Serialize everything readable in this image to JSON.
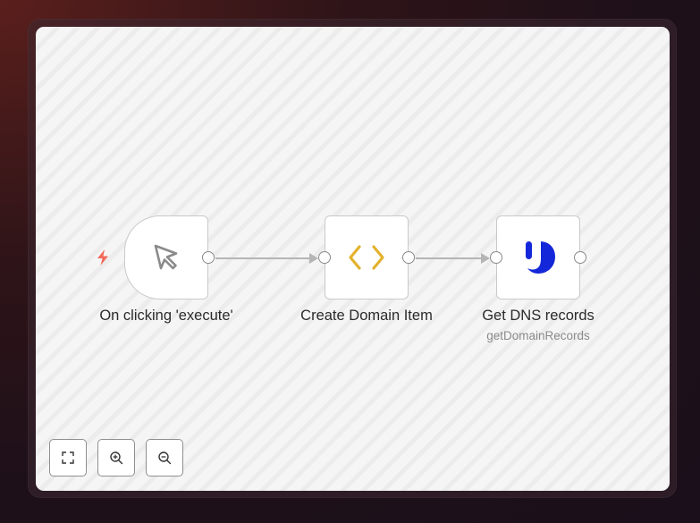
{
  "canvas": {
    "nodes": [
      {
        "id": "trigger",
        "label": "On clicking 'execute'",
        "icon": "cursor-icon",
        "icon_color": "#8a8a8a",
        "kind": "trigger"
      },
      {
        "id": "code",
        "label": "Create Domain Item",
        "icon": "code-brackets-icon",
        "icon_color": "#e3b22d"
      },
      {
        "id": "dns",
        "label": "Get DNS records",
        "subtitle": "getDomainRecords",
        "icon": "jsonbin-logo-icon",
        "icon_color": "#1428d9"
      }
    ],
    "trigger_icon": "bolt-icon",
    "trigger_icon_color": "#f26b5b"
  },
  "controls": {
    "buttons": [
      {
        "name": "fit-view-button",
        "icon": "fullscreen-icon"
      },
      {
        "name": "zoom-in-button",
        "icon": "zoom-in-icon"
      },
      {
        "name": "zoom-out-button",
        "icon": "zoom-out-icon"
      }
    ]
  }
}
